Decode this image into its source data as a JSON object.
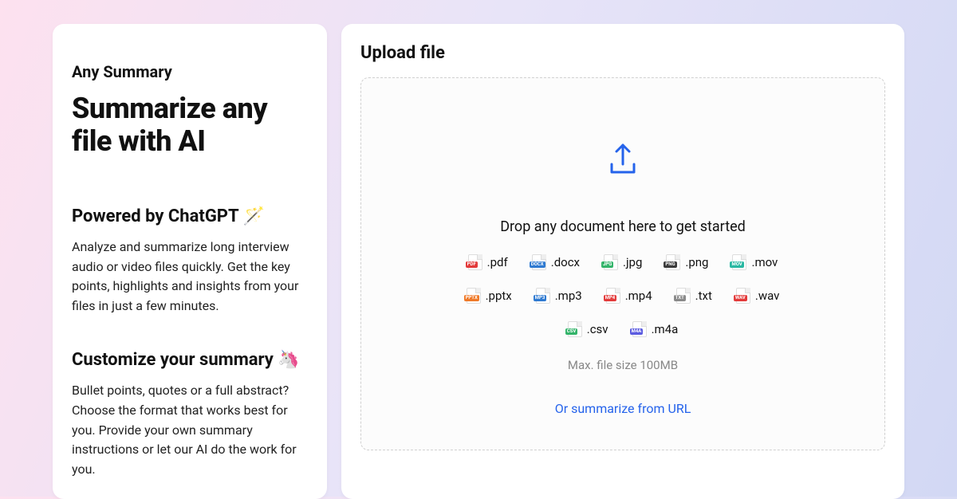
{
  "left": {
    "brand": "Any Summary",
    "headline": "Summarize any file with AI",
    "section1_title": "Powered by ChatGPT 🪄",
    "section1_body": "Analyze and summarize long interview audio or video files quickly. Get the key points, highlights and insights from your files in just a few minutes.",
    "section2_title": "Customize your summary 🦄",
    "section2_body": "Bullet points, quotes or a full abstract? Choose the format that works best for you. Provide your own summary instructions or let our AI do the work for you."
  },
  "upload": {
    "title": "Upload file",
    "drop_message": "Drop any document here to get started",
    "max_size": "Max. file size 100MB",
    "url_link": "Or summarize from URL",
    "formats": [
      {
        "label": ".pdf",
        "badge": "PDF",
        "color": "c-red"
      },
      {
        "label": ".docx",
        "badge": "DOCX",
        "color": "c-blue"
      },
      {
        "label": ".jpg",
        "badge": "JPG",
        "color": "c-green"
      },
      {
        "label": ".png",
        "badge": "PNG",
        "color": "c-dark"
      },
      {
        "label": ".mov",
        "badge": "MOV",
        "color": "c-teal"
      },
      {
        "label": ".pptx",
        "badge": "PPTX",
        "color": "c-orange"
      },
      {
        "label": ".mp3",
        "badge": "MP3",
        "color": "c-blue"
      },
      {
        "label": ".mp4",
        "badge": "MP4",
        "color": "c-red"
      },
      {
        "label": ".txt",
        "badge": "TXT",
        "color": "c-gray"
      },
      {
        "label": ".wav",
        "badge": "WAV",
        "color": "c-red"
      },
      {
        "label": ".csv",
        "badge": "CSV",
        "color": "c-green"
      },
      {
        "label": ".m4a",
        "badge": "M4A",
        "color": "c-purple"
      }
    ]
  }
}
